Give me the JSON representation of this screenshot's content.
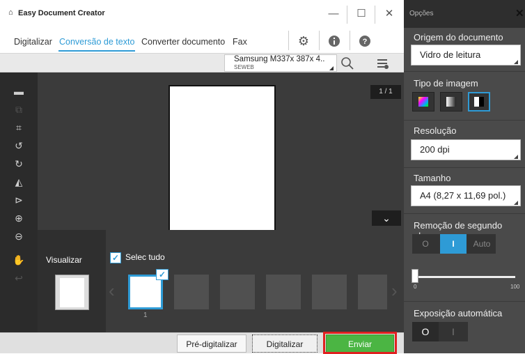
{
  "window": {
    "title": "Easy Document Creator",
    "home_icon": "home-icon",
    "minimize": "—",
    "maximize": "☐",
    "close": "✕"
  },
  "tabs": [
    "Digitalizar",
    "Conversão de texto",
    "Converter documento",
    "Fax"
  ],
  "active_tab_index": 1,
  "toolbar_icons": [
    "gear-icon",
    "info-icon",
    "help-icon"
  ],
  "device": {
    "name": "Samsung M337x 387x 4..",
    "sub": "SEWEB"
  },
  "preview": {
    "page_counter": "1 / 1",
    "panel_label": "Visualizar",
    "select_all_label": "Selec tudo",
    "thumb_number": "1"
  },
  "bottom_buttons": {
    "prescan": "Pré-digitalizar",
    "scan": "Digitalizar",
    "send": "Enviar"
  },
  "options_panel": {
    "title": "Opções",
    "origin_label": "Origem do documento",
    "origin_value": "Vidro de leitura",
    "image_type_label": "Tipo de imagem",
    "image_type_selected_index": 2,
    "resolution_label": "Resolução",
    "resolution_value": "200 dpi",
    "size_label": "Tamanho",
    "size_value": "A4 (8,27 x 11,69 pol.)",
    "background_label": "Remoção de segundo plano",
    "background_options": [
      "O",
      "I",
      "Auto"
    ],
    "background_selected_index": 1,
    "slider_min": "0",
    "slider_max": "100",
    "slider_value": 0,
    "exposure_label": "Exposição automática",
    "exposure_options": [
      "O",
      "I"
    ]
  },
  "colors": {
    "accent": "#2e9bd6",
    "send_button": "#4bb543",
    "highlight": "#e02020",
    "panel_bg": "#4a4a4a"
  }
}
